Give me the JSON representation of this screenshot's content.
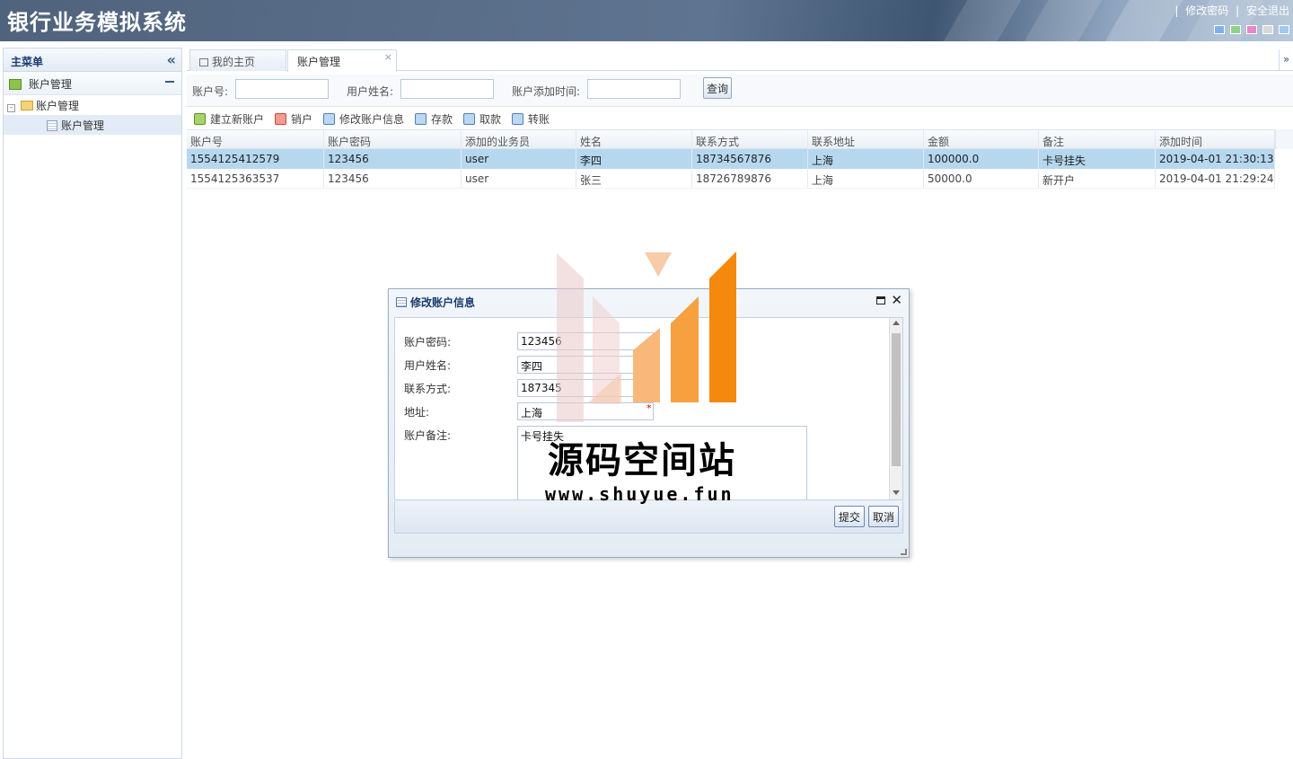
{
  "app": {
    "title": "银行业务模拟系统",
    "links": {
      "sep1": "|",
      "change_password": "修改密码",
      "sep2": "|",
      "logout": "安全退出"
    },
    "theme_colors": [
      "#7fb0e8",
      "#8fd18b",
      "#e687c9",
      "#d9d9d9",
      "#9fc9ef"
    ]
  },
  "sidebar": {
    "title": "主菜单",
    "group": "账户管理",
    "tree": {
      "folder": "账户管理",
      "leaf": "账户管理",
      "toggle": "-"
    }
  },
  "tabs": [
    {
      "label": "我的主页"
    },
    {
      "label": "账户管理",
      "close": "×"
    }
  ],
  "tab_more": "»",
  "search": {
    "account_label": "账户号:",
    "name_label": "用户姓名:",
    "time_label": "账户添加时间:",
    "query_button": "查询"
  },
  "toolbar": {
    "create": "建立新账户",
    "close_account": "销户",
    "edit": "修改账户信息",
    "deposit": "存款",
    "withdraw": "取款",
    "transfer": "转账"
  },
  "grid": {
    "headers": [
      "账户号",
      "账户密码",
      "添加的业务员",
      "姓名",
      "联系方式",
      "联系地址",
      "金额",
      "备注",
      "添加时间"
    ],
    "rows": [
      [
        "1554125412579",
        "123456",
        "user",
        "李四",
        "18734567876",
        "上海",
        "100000.0",
        "卡号挂失",
        "2019-04-01 21:30:13"
      ],
      [
        "1554125363537",
        "123456",
        "user",
        "张三",
        "18726789876",
        "上海",
        "50000.0",
        "新开户",
        "2019-04-01 21:29:24"
      ]
    ]
  },
  "dialog": {
    "title": "修改账户信息",
    "close": "✕",
    "fields": {
      "password_label": "账户密码:",
      "password_value": "123456",
      "name_label": "用户姓名:",
      "name_value": "李四",
      "phone_label": "联系方式:",
      "phone_value": "187345",
      "address_label": "地址:",
      "address_value": "上海",
      "note_label": "账户备注:",
      "note_value": "卡号挂失",
      "required_mark": "*"
    },
    "submit": "提交",
    "cancel": "取消"
  },
  "watermark": {
    "text": "源码空间站",
    "url": "www.shuyue.fun"
  }
}
